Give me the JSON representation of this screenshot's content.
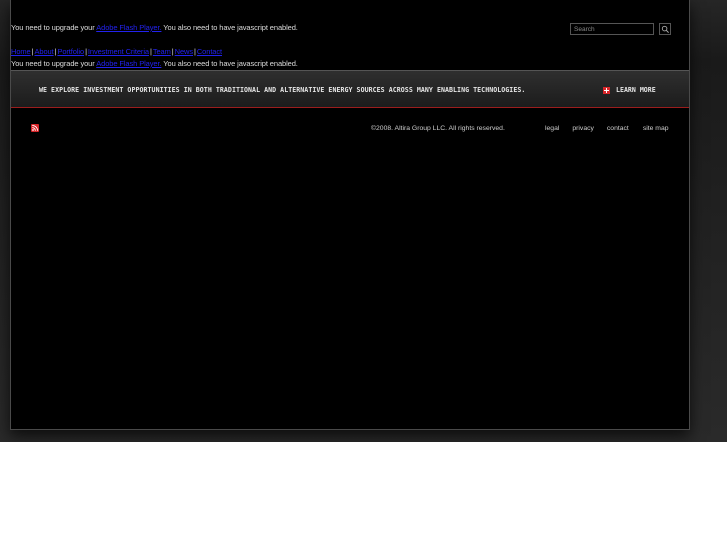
{
  "flash_notice": {
    "prefix": "You need to upgrade your ",
    "link": "Adobe Flash Player.",
    "suffix": " You also need to have javascript enabled."
  },
  "search": {
    "placeholder": "Search",
    "button_icon": "magnifier-icon"
  },
  "nav": {
    "items": [
      "Home",
      "About",
      "Portfolio",
      "Investment Criteria",
      "Team",
      "News",
      "Contact"
    ],
    "separator": "|"
  },
  "tagline_bar": {
    "text": "WE EXPLORE INVESTMENT OPPORTUNITIES IN BOTH TRADITIONAL AND ALTERNATIVE ENERGY SOURCES ACROSS MANY ENABLING TECHNOLOGIES.",
    "learn_more": "LEARN MORE",
    "learn_more_icon": "plus-icon"
  },
  "footer": {
    "rss_icon": "rss-icon",
    "copyright": "©2008. Altira Group LLC. All rights reserved.",
    "links": {
      "legal": "legal",
      "privacy": "privacy",
      "contact": "contact",
      "site_map": "site map"
    }
  },
  "colors": {
    "background": "#000000",
    "link": "#2222ee",
    "accent_red": "#d8262a",
    "text": "#dcdcdc"
  }
}
